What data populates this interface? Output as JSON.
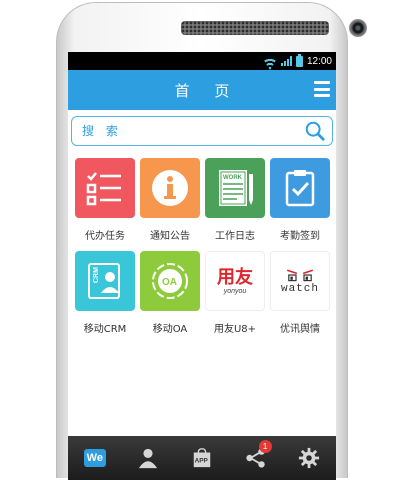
{
  "status_bar": {
    "time": "12:00"
  },
  "header": {
    "title": "首 页"
  },
  "search": {
    "placeholder": "搜 索"
  },
  "apps": [
    {
      "label": "代办任务",
      "icon": "task-list-icon",
      "color": "#f0575e"
    },
    {
      "label": "通知公告",
      "icon": "info-icon",
      "color": "#f7964d"
    },
    {
      "label": "工作日志",
      "icon": "work-log-icon",
      "color": "#4ba05a"
    },
    {
      "label": "考勤签到",
      "icon": "checkin-clipboard-icon",
      "color": "#3e9be0"
    },
    {
      "label": "移动CRM",
      "icon": "crm-icon",
      "color": "#39c6d8"
    },
    {
      "label": "移动OA",
      "icon": "oa-icon",
      "color": "#8ecb3c"
    },
    {
      "label": "用友U8+",
      "icon": "yonyou-logo",
      "color": "#ffffff",
      "logo_text": "用友",
      "logo_sub": "yonyou"
    },
    {
      "label": "优讯舆情",
      "icon": "watch-logo",
      "color": "#ffffff",
      "logo_text": "watch"
    }
  ],
  "tabbar": {
    "items": [
      {
        "name": "home",
        "icon": "we-icon",
        "text": "We"
      },
      {
        "name": "contacts",
        "icon": "person-icon"
      },
      {
        "name": "apps",
        "icon": "app-bag-icon",
        "text": "APP"
      },
      {
        "name": "share",
        "icon": "share-icon",
        "badge": "1"
      },
      {
        "name": "settings",
        "icon": "gear-icon"
      }
    ]
  }
}
